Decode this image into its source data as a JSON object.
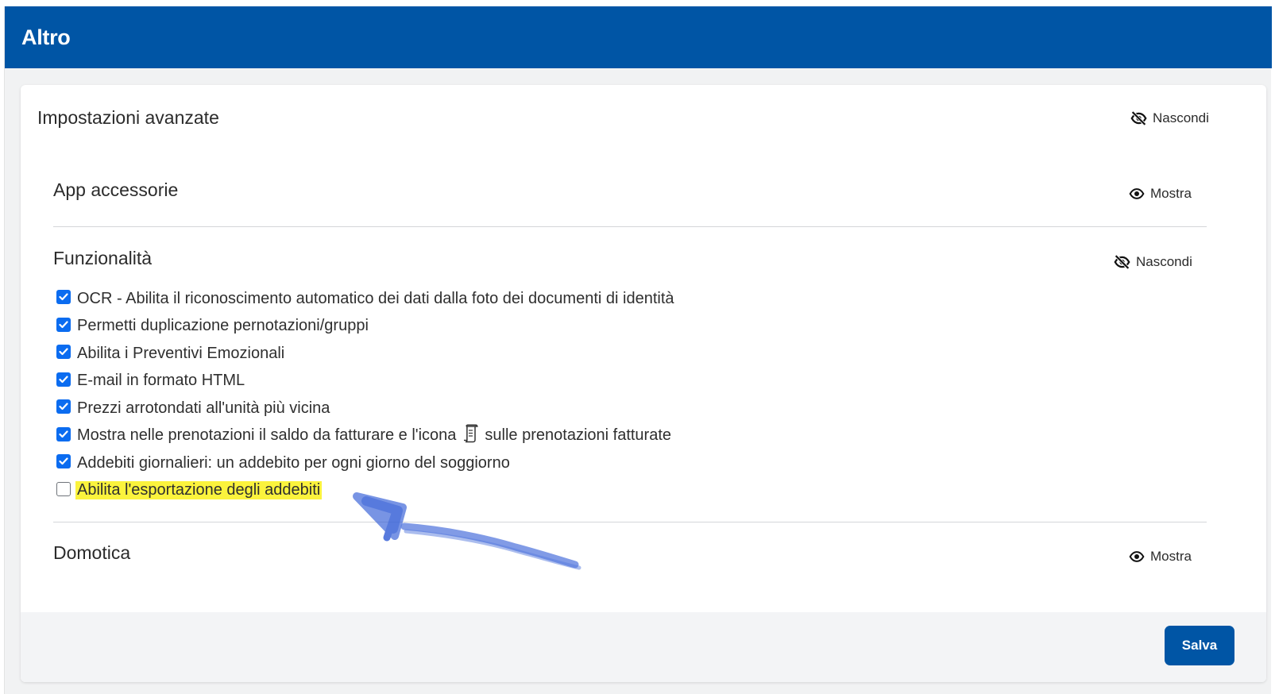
{
  "header": {
    "title": "Altro"
  },
  "card": {
    "section_title": "Impostazioni avanzate",
    "hide_label": "Nascondi",
    "subsections": [
      {
        "title": "App accessorie",
        "toggle_label": "Mostra"
      },
      {
        "title": "Funzionalità",
        "toggle_label": "Nascondi"
      },
      {
        "title": "Domotica",
        "toggle_label": "Mostra"
      }
    ],
    "options": [
      {
        "label": "OCR - Abilita il riconoscimento automatico dei dati dalla foto dei documenti di identità",
        "checked": true
      },
      {
        "label": "Permetti duplicazione pernotazioni/gruppi",
        "checked": true
      },
      {
        "label": "Abilita i Preventivi Emozionali",
        "checked": true
      },
      {
        "label": "E-mail in formato HTML",
        "checked": true
      },
      {
        "label": "Prezzi arrotondati all'unità più vicina",
        "checked": true
      },
      {
        "label_before": "Mostra nelle prenotazioni il saldo da fatturare e l'icona",
        "icon": "invoice-scroll-icon",
        "label_after": "sulle prenotazioni fatturate",
        "checked": true
      },
      {
        "label": "Addebiti giornalieri: un addebito per ogni giorno del soggiorno",
        "checked": true
      },
      {
        "label": "Abilita l'esportazione degli addebiti",
        "checked": false,
        "highlighted": true
      }
    ],
    "save_label": "Salva"
  },
  "colors": {
    "header_bg": "#0055a5",
    "checkbox_checked": "#0b6cf0",
    "highlight": "#fbf33d",
    "annotation_arrow": "#3a63d8"
  }
}
